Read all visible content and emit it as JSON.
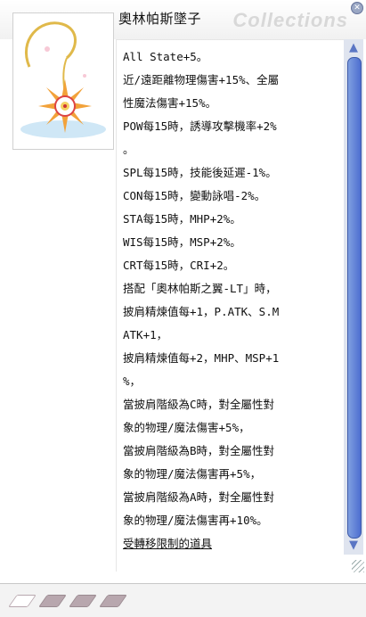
{
  "window": {
    "title": "奧林帕斯墜子",
    "watermark": "Collections"
  },
  "description": {
    "lines": [
      "All State+5。",
      "近/遠距離物理傷害+15%、全屬",
      "性魔法傷害+15%。",
      "POW每15時，誘導攻擊機率+2%",
      "。",
      "SPL每15時，技能後延遲-1%。",
      "CON每15時，變動詠唱-2%。",
      "STA每15時，MHP+2%。",
      "WIS每15時，MSP+2%。",
      "CRT每15時，CRI+2。",
      "搭配「奧林帕斯之翼-LT」時，",
      "披肩精煉值每+1，P.ATK、S.M",
      "ATK+1，",
      "披肩精煉值每+2，MHP、MSP+1",
      "%，",
      "當披肩階級為C時，對全屬性對",
      "象的物理/魔法傷害+5%，",
      "當披肩階級為B時，對全屬性對",
      "象的物理/魔法傷害再+5%，",
      "當披肩階級為A時，對全屬性對",
      "象的物理/魔法傷害再+10%。"
    ],
    "restriction": "受轉移限制的道具"
  },
  "bottom_slots": [
    {
      "color": "#ffffff"
    },
    {
      "color": "#b8a7ae"
    },
    {
      "color": "#b8a7ae"
    },
    {
      "color": "#b8a7ae"
    }
  ]
}
